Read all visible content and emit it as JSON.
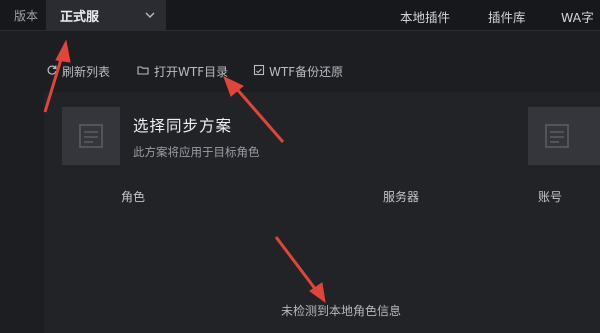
{
  "topbar": {
    "version_label": "版本",
    "version_value": "正式服",
    "nav": [
      "本地插件",
      "插件库",
      "WA字"
    ]
  },
  "toolbar": {
    "refresh_label": "刷新列表",
    "open_wtf_label": "打开WTF目录",
    "wtf_restore_label": "WTF备份还原"
  },
  "plan": {
    "title": "选择同步方案",
    "subtitle": "此方案将应用于目标角色"
  },
  "table": {
    "columns": [
      "角色",
      "服务器",
      "账号"
    ]
  },
  "empty_message": "未检测到本地角色信息",
  "colors": {
    "background": "#1d1e22",
    "topbar": "#17181b",
    "annotation_arrow": "#e0453a"
  },
  "icons": [
    "chevron-down-icon",
    "refresh-icon",
    "folder-icon",
    "backup-icon",
    "scroll-icon"
  ]
}
